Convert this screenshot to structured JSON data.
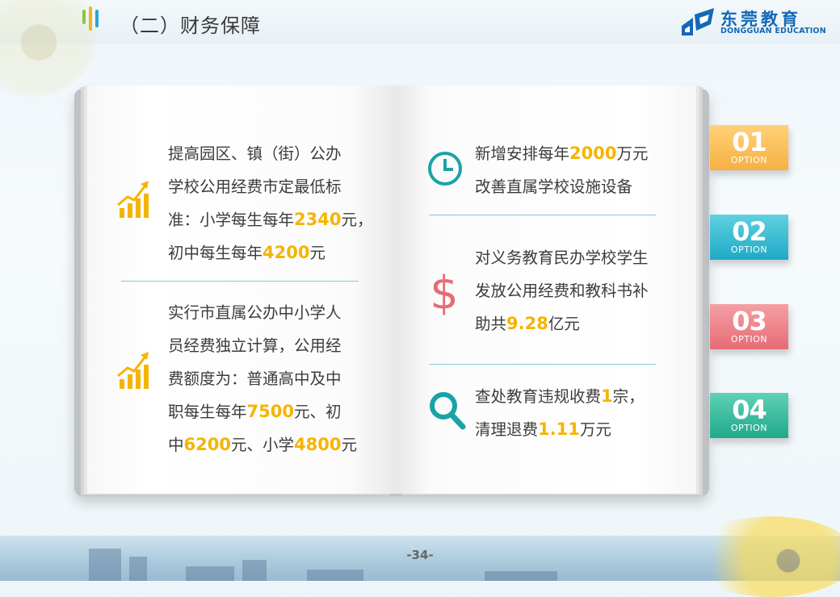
{
  "header": {
    "section_title": "（二）财务保障",
    "logo_cn": "东莞教育",
    "logo_en": "DONGGUAN EDUCATION"
  },
  "left_page": {
    "item1": {
      "icon": "growth-chart-icon",
      "line1": "提高园区、镇（街）公办",
      "line2": "学校公用经费市定最低标",
      "line3_a": "准：小学每生每年",
      "line3_hl": "2340",
      "line3_b": "元，",
      "line4_a": "初中每生每年",
      "line4_hl": "4200",
      "line4_b": "元"
    },
    "item2": {
      "icon": "growth-chart-icon",
      "line1": "实行市直属公办中小学人",
      "line2": "员经费独立计算，公用经",
      "line3": "费额度为：普通高中及中",
      "line4_a": "职每生每年",
      "line4_hl": "7500",
      "line4_b": "元、初",
      "line5_a": "中",
      "line5_hl1": "6200",
      "line5_b": "元、小学",
      "line5_hl2": "4800",
      "line5_c": "元"
    }
  },
  "right_page": {
    "item1": {
      "icon": "clock-icon",
      "line1_a": "新增安排每年",
      "line1_hl": "2000",
      "line1_b": "万元",
      "line2": "改善直属学校设施设备"
    },
    "item2": {
      "icon": "dollar-icon",
      "line1": "对义务教育民办学校学生",
      "line2": "发放公用经费和教科书补",
      "line3_a": "助共",
      "line3_hl": "9.28",
      "line3_b": "亿元"
    },
    "item3": {
      "icon": "search-icon",
      "line1_a": "查处教育违规收费",
      "line1_hl": "1",
      "line1_b": "宗，",
      "line2_a": "清理退费",
      "line2_hl": "1.11",
      "line2_b": "万元"
    }
  },
  "tabs": [
    {
      "num": "01",
      "label": "OPTION",
      "color": "#f6b042"
    },
    {
      "num": "02",
      "label": "OPTION",
      "color": "#1fa9c6"
    },
    {
      "num": "03",
      "label": "OPTION",
      "color": "#e56c74"
    },
    {
      "num": "04",
      "label": "OPTION",
      "color": "#20a98a"
    }
  ],
  "footer": {
    "page_number": "-34-"
  },
  "colors": {
    "highlight": "#f5b400",
    "icon_orange": "#f5b400",
    "icon_teal": "#1aa3a6",
    "icon_red": "#e56c74"
  }
}
